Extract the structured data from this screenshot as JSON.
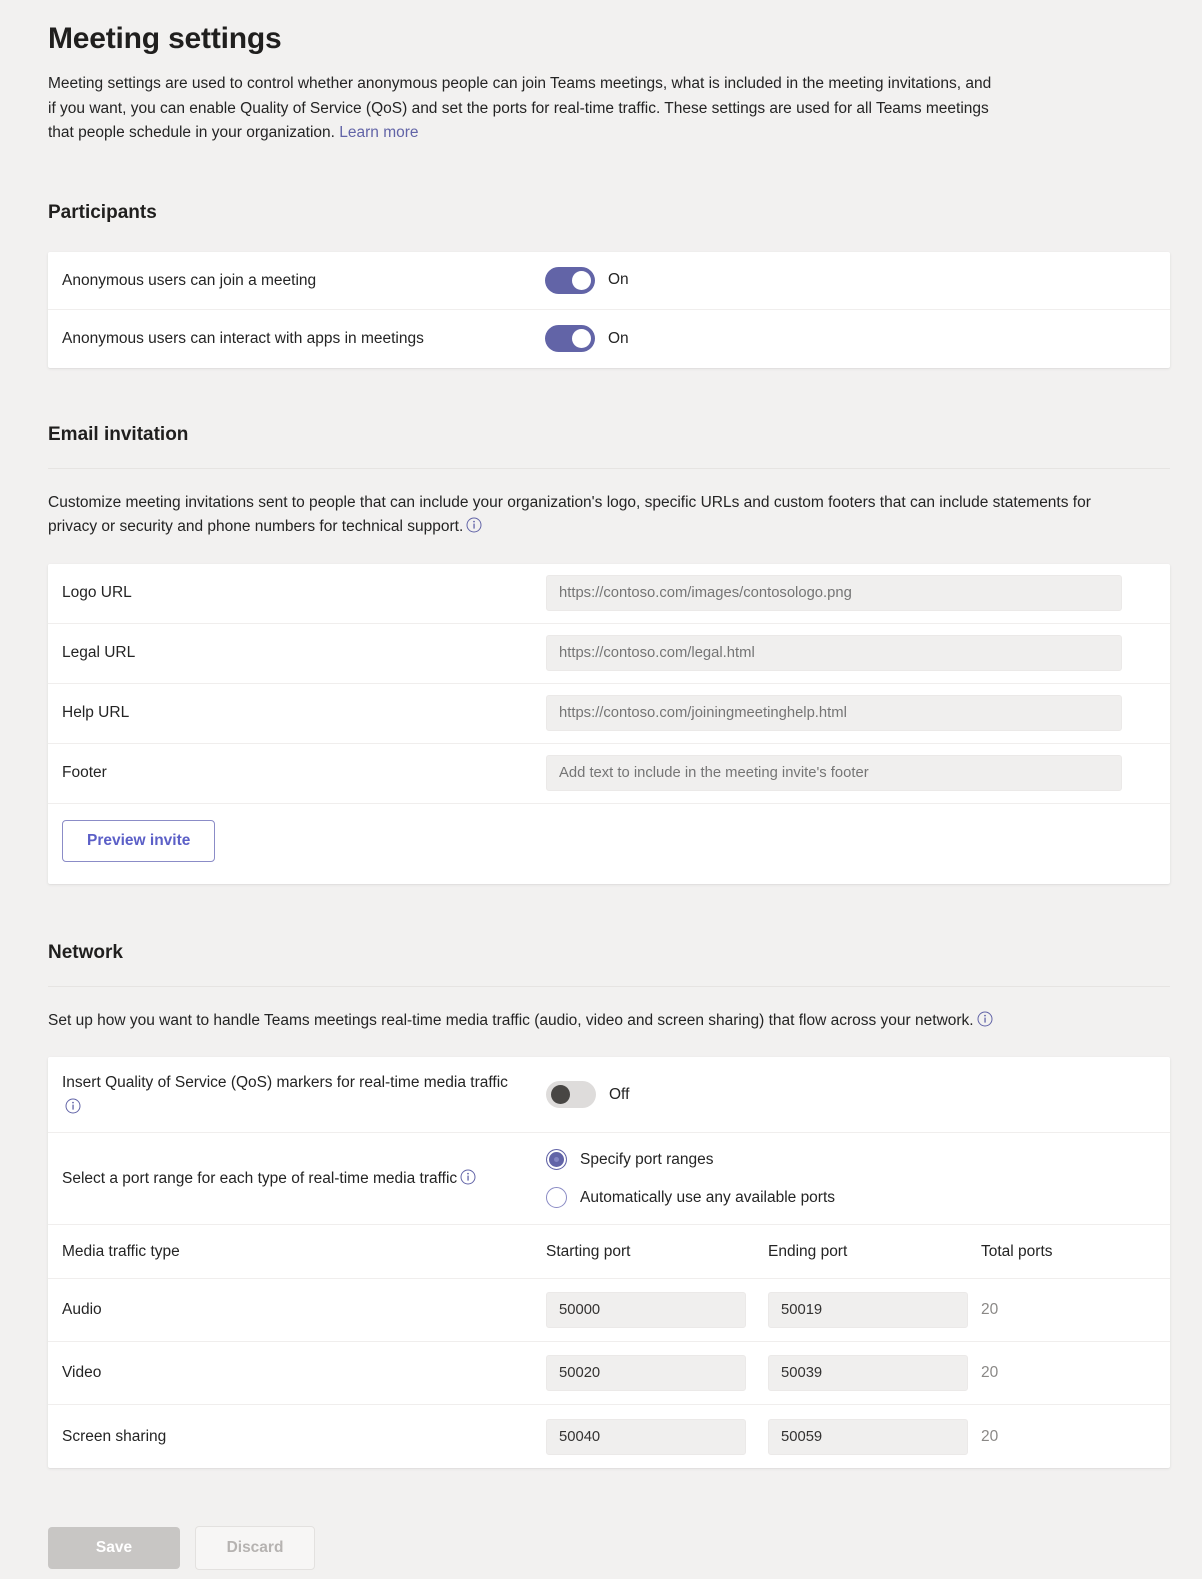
{
  "header": {
    "title": "Meeting settings",
    "description_part1": "Meeting settings are used to control whether anonymous people can join Teams meetings, what is included in the meeting invitations, and if you want, you can enable Quality of Service (QoS) and set the ports for real-time traffic. These settings are used for all Teams meetings that people schedule in your organization. ",
    "learn_more": "Learn more"
  },
  "participants": {
    "title": "Participants",
    "rows": [
      {
        "label": "Anonymous users can join a meeting",
        "state": "On"
      },
      {
        "label": "Anonymous users can interact with apps in meetings",
        "state": "On"
      }
    ]
  },
  "email_invitation": {
    "title": "Email invitation",
    "description": "Customize meeting invitations sent to people that can include your organization's logo, specific URLs and custom footers that can include statements for privacy or security and phone numbers for technical support.",
    "fields": [
      {
        "label": "Logo URL",
        "placeholder": "https://contoso.com/images/contosologo.png",
        "value": ""
      },
      {
        "label": "Legal URL",
        "placeholder": "https://contoso.com/legal.html",
        "value": ""
      },
      {
        "label": "Help URL",
        "placeholder": "https://contoso.com/joiningmeetinghelp.html",
        "value": ""
      },
      {
        "label": "Footer",
        "placeholder": "Add text to include in the meeting invite's footer",
        "value": ""
      }
    ],
    "preview_button": "Preview invite"
  },
  "network": {
    "title": "Network",
    "description": "Set up how you want to handle Teams meetings real-time media traffic (audio, video and screen sharing) that flow across your network.",
    "qos": {
      "label": "Insert Quality of Service (QoS) markers for real-time media traffic",
      "state": "Off"
    },
    "port_range": {
      "label": "Select a port range for each type of real-time media traffic",
      "options": [
        {
          "label": "Specify port ranges",
          "selected": true
        },
        {
          "label": "Automatically use any available ports",
          "selected": false
        }
      ]
    },
    "table": {
      "columns": [
        "Media traffic type",
        "Starting port",
        "Ending port",
        "Total ports"
      ],
      "rows": [
        {
          "type": "Audio",
          "start": "50000",
          "end": "50019",
          "total": "20"
        },
        {
          "type": "Video",
          "start": "50020",
          "end": "50039",
          "total": "20"
        },
        {
          "type": "Screen sharing",
          "start": "50040",
          "end": "50059",
          "total": "20"
        }
      ]
    }
  },
  "footer": {
    "save": "Save",
    "discard": "Discard"
  },
  "colors": {
    "accent": "#6264a7",
    "link": "#6264a7",
    "page_bg": "#f2f1f0",
    "card_bg": "#ffffff",
    "input_bg": "#f0efee",
    "toggle_off": "#dedcdb"
  }
}
